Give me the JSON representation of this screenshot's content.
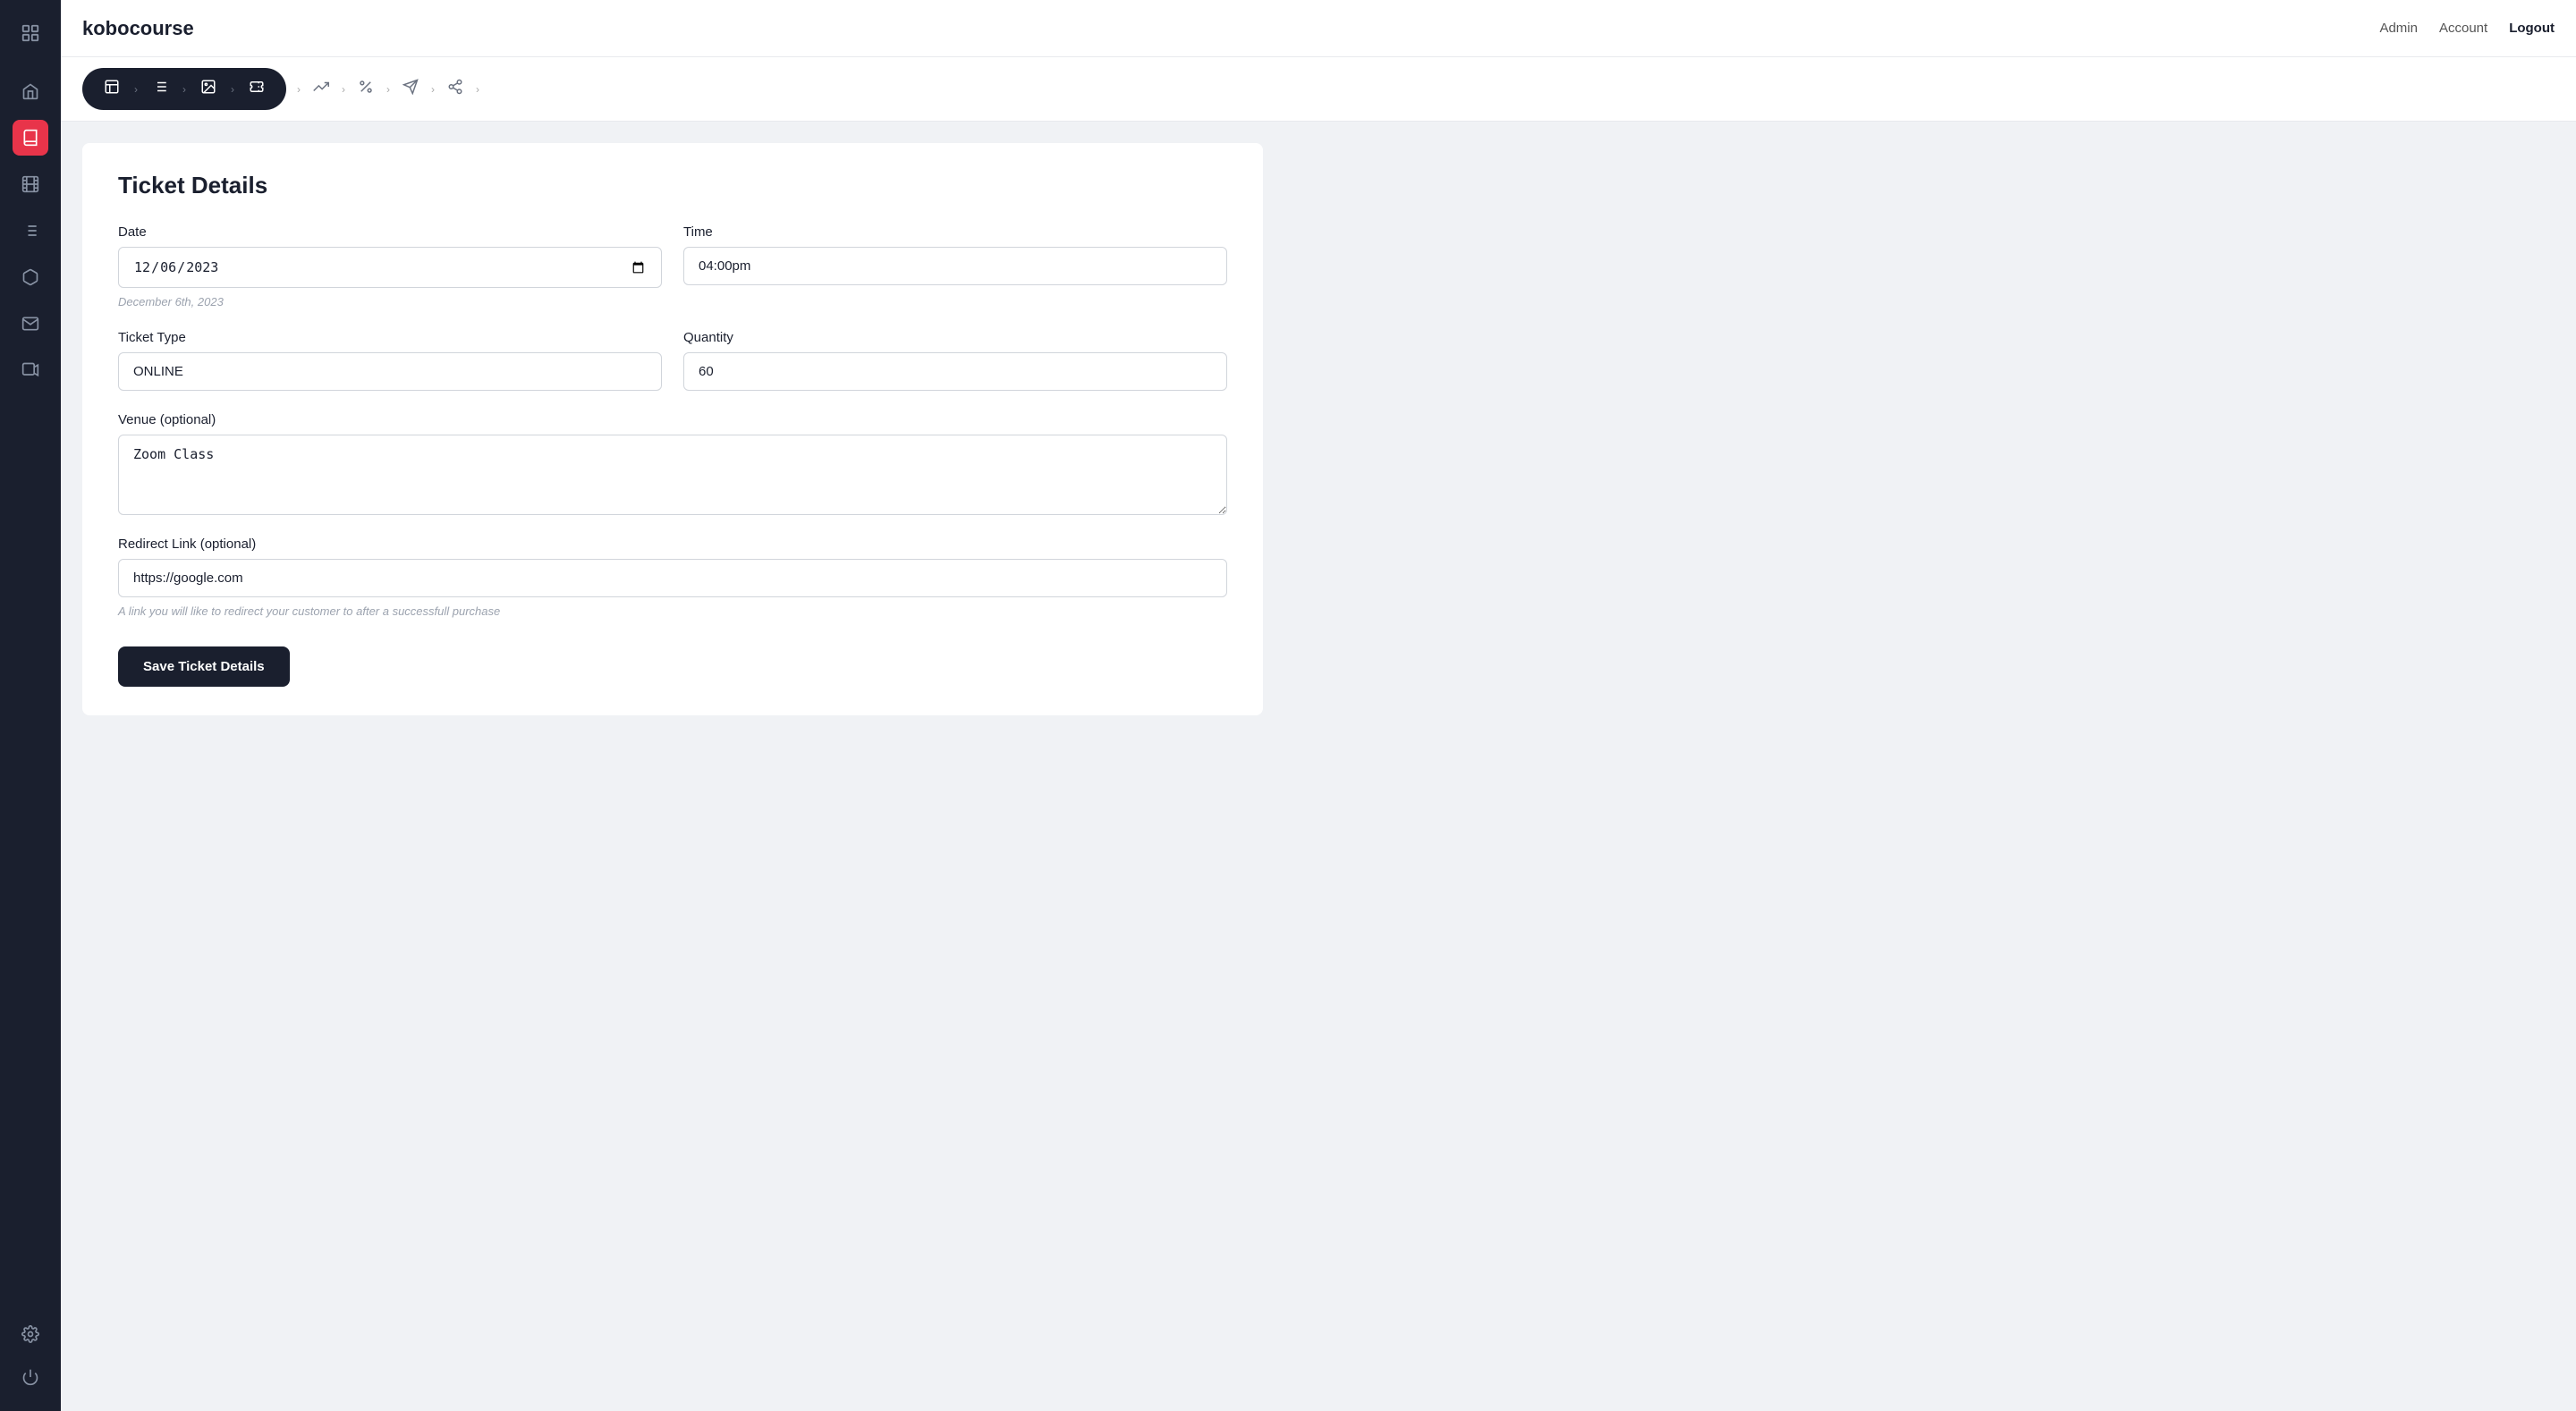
{
  "app": {
    "logo_text1": "kobo",
    "logo_text2": "course"
  },
  "topnav": {
    "admin_label": "Admin",
    "account_label": "Account",
    "logout_label": "Logout"
  },
  "wizard": {
    "steps_active": [
      {
        "icon": "🖼",
        "id": "details"
      },
      {
        "icon": "≡",
        "id": "outline"
      },
      {
        "icon": "🖼",
        "id": "media"
      },
      {
        "icon": "🎟",
        "id": "ticket"
      }
    ],
    "steps_inactive": [
      {
        "icon": "↗",
        "id": "stats"
      },
      {
        "icon": "%",
        "id": "discount"
      },
      {
        "icon": "✉",
        "id": "invite"
      },
      {
        "icon": "⊙",
        "id": "share"
      }
    ]
  },
  "form": {
    "title": "Ticket Details",
    "date_label": "Date",
    "date_value": "06/12/2023",
    "date_note": "December 6th, 2023",
    "time_label": "Time",
    "time_value": "04:00pm",
    "ticket_type_label": "Ticket Type",
    "ticket_type_value": "ONLINE",
    "quantity_label": "Quantity",
    "quantity_value": "60",
    "venue_label": "Venue (optional)",
    "venue_value": "Zoom Class",
    "redirect_label": "Redirect Link (optional)",
    "redirect_value": "https://google.com",
    "redirect_hint": "A link you will like to redirect your customer to after a successfull purchase",
    "save_button_label": "Save Ticket Details"
  },
  "sidebar": {
    "icons": [
      {
        "id": "home",
        "symbol": "🏠"
      },
      {
        "id": "book",
        "symbol": "📖"
      },
      {
        "id": "film",
        "symbol": "🎬"
      },
      {
        "id": "list",
        "symbol": "📋"
      },
      {
        "id": "box",
        "symbol": "📦"
      },
      {
        "id": "mail",
        "symbol": "✉"
      },
      {
        "id": "video",
        "symbol": "▶"
      },
      {
        "id": "settings",
        "symbol": "⚙"
      }
    ]
  }
}
